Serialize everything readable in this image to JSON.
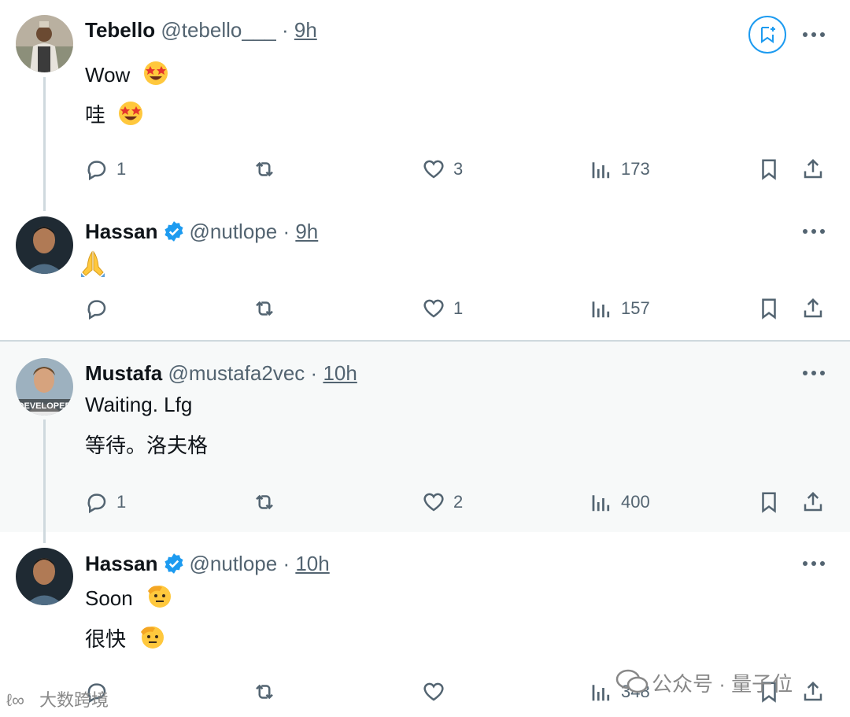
{
  "colors": {
    "accent": "#1d9bf0",
    "muted": "#536471",
    "text": "#0f1419",
    "verified": "#1d9bf0"
  },
  "posts": [
    {
      "name": "Tebello",
      "handle": "@tebello___",
      "sep": "·",
      "time": "9h",
      "verified": false,
      "lines": [
        "Wow",
        "哇"
      ],
      "emoji": "star-struck",
      "replies": "1",
      "reposts": "",
      "likes": "3",
      "views": "173"
    },
    {
      "name": "Hassan",
      "handle": "@nutlope",
      "sep": "·",
      "time": "9h",
      "verified": true,
      "lines": [
        ""
      ],
      "emoji": "folded-hands",
      "replies": "",
      "reposts": "",
      "likes": "1",
      "views": "157"
    },
    {
      "name": "Mustafa",
      "handle": "@mustafa2vec",
      "sep": "·",
      "time": "10h",
      "verified": false,
      "avatar_label": "DEVELOPER",
      "lines": [
        "Waiting. Lfg",
        "等待。洛夫格"
      ],
      "replies": "1",
      "reposts": "",
      "likes": "2",
      "views": "400"
    },
    {
      "name": "Hassan",
      "handle": "@nutlope",
      "sep": "·",
      "time": "10h",
      "verified": true,
      "lines": [
        "Soon",
        "很快"
      ],
      "emoji": "saluting-face",
      "replies": "",
      "reposts": "",
      "likes": "",
      "views": "348"
    }
  ],
  "watermarks": {
    "left": "大数跨境",
    "right": "公众号 · 量子位"
  }
}
